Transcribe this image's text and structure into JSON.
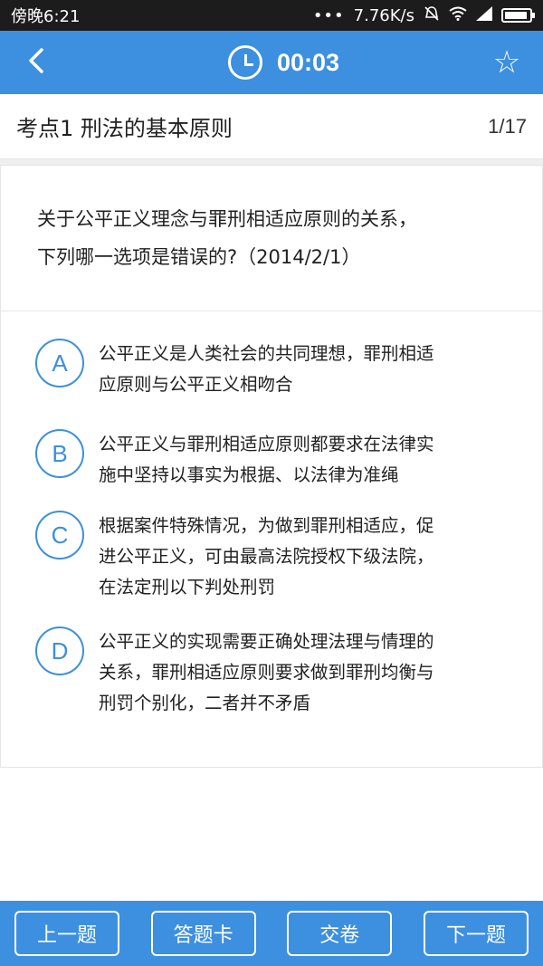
{
  "status_bar": {
    "time": "傍晚6:21",
    "network_speed": "7.76K/s",
    "icons": [
      "more-dots-icon",
      "mute-icon",
      "wifi-icon",
      "signal-icon",
      "battery-icon"
    ]
  },
  "header": {
    "timer": "00:03",
    "back_icon": "chevron-left-icon",
    "clock_icon": "clock-icon",
    "favorite_icon": "star-outline-icon",
    "star_glyph": "☆"
  },
  "section": {
    "title": "考点1 刑法的基本原则",
    "progress": "1/17"
  },
  "question": {
    "line1": "关于公平正义理念与罪刑相适应原则的关系，",
    "line2": "下列哪一选项是错误的?（2014/2/1）",
    "options": [
      {
        "letter": "A",
        "lines": [
          "公平正义是人类社会的共同理想，罪刑相适",
          "应原则与公平正义相吻合"
        ]
      },
      {
        "letter": "B",
        "lines": [
          "公平正义与罪刑相适应原则都要求在法律实",
          "施中坚持以事实为根据、以法律为准绳"
        ]
      },
      {
        "letter": "C",
        "lines": [
          "根据案件特殊情况，为做到罪刑相适应，促",
          "进公平正义，可由最高法院授权下级法院，",
          "在法定刑以下判处刑罚"
        ]
      },
      {
        "letter": "D",
        "lines": [
          "公平正义的实现需要正确处理法理与情理的",
          "关系，罪刑相适应原则要求做到罪刑均衡与",
          "刑罚个别化，二者并不矛盾"
        ]
      }
    ]
  },
  "footer": {
    "prev": "上一题",
    "card": "答题卡",
    "submit": "交卷",
    "next": "下一题"
  },
  "colors": {
    "primary": "#3d8fe0",
    "status_bar": "#1c1c1c"
  }
}
